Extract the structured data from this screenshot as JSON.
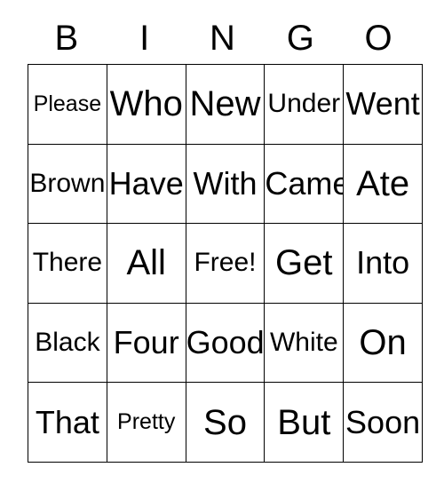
{
  "card": {
    "title": "BINGO",
    "header": {
      "letters": [
        "B",
        "I",
        "N",
        "G",
        "O"
      ]
    },
    "grid": {
      "columns": 5,
      "rows": 5,
      "free_space": "Free!",
      "free_space_position": {
        "row": 2,
        "col": 2
      },
      "cells": [
        [
          "Please",
          "Who",
          "New",
          "Under",
          "Went"
        ],
        [
          "Brown",
          "Have",
          "With",
          "Came",
          "Ate"
        ],
        [
          "There",
          "All",
          "Free!",
          "Get",
          "Into"
        ],
        [
          "Black",
          "Four",
          "Good",
          "White",
          "On"
        ],
        [
          "That",
          "Pretty",
          "So",
          "But",
          "Soon"
        ]
      ]
    },
    "colors": {
      "background": "#ffffff",
      "text": "#000000",
      "border": "#000000"
    }
  }
}
